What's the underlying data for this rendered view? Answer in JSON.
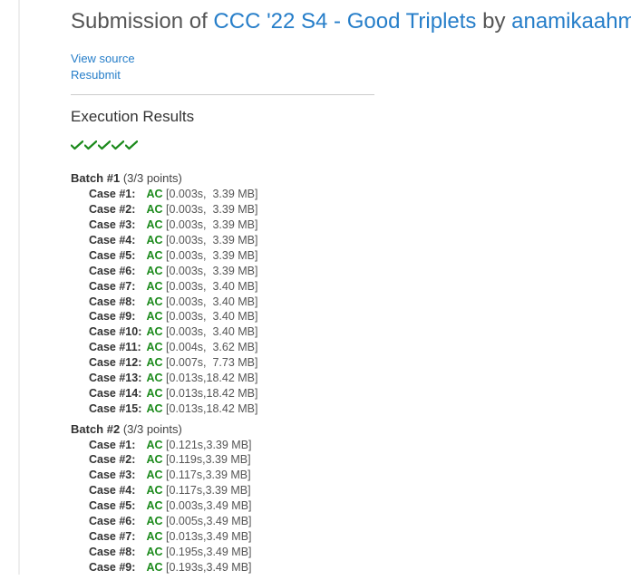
{
  "title": {
    "prefix": "Submission of ",
    "problem": "CCC '22 S4 - Good Triplets",
    "by": " by ",
    "user": "anamikaahmed"
  },
  "actions": {
    "view_source": "View source",
    "resubmit": "Resubmit"
  },
  "section_header": "Execution Results",
  "check_count": 5,
  "batches": [
    {
      "label": "Batch #1",
      "points": "(3/3 points)",
      "cases": [
        {
          "n": "Case #1:",
          "status": "AC",
          "meta": "[0.003s,  3.39 MB]"
        },
        {
          "n": "Case #2:",
          "status": "AC",
          "meta": "[0.003s,  3.39 MB]"
        },
        {
          "n": "Case #3:",
          "status": "AC",
          "meta": "[0.003s,  3.39 MB]"
        },
        {
          "n": "Case #4:",
          "status": "AC",
          "meta": "[0.003s,  3.39 MB]"
        },
        {
          "n": "Case #5:",
          "status": "AC",
          "meta": "[0.003s,  3.39 MB]"
        },
        {
          "n": "Case #6:",
          "status": "AC",
          "meta": "[0.003s,  3.39 MB]"
        },
        {
          "n": "Case #7:",
          "status": "AC",
          "meta": "[0.003s,  3.40 MB]"
        },
        {
          "n": "Case #8:",
          "status": "AC",
          "meta": "[0.003s,  3.40 MB]"
        },
        {
          "n": "Case #9:",
          "status": "AC",
          "meta": "[0.003s,  3.40 MB]"
        },
        {
          "n": "Case #10:",
          "status": "AC",
          "meta": "[0.003s,  3.40 MB]"
        },
        {
          "n": "Case #11:",
          "status": "AC",
          "meta": "[0.004s,  3.62 MB]"
        },
        {
          "n": "Case #12:",
          "status": "AC",
          "meta": "[0.007s,  7.73 MB]"
        },
        {
          "n": "Case #13:",
          "status": "AC",
          "meta": "[0.013s,18.42 MB]"
        },
        {
          "n": "Case #14:",
          "status": "AC",
          "meta": "[0.013s,18.42 MB]"
        },
        {
          "n": "Case #15:",
          "status": "AC",
          "meta": "[0.013s,18.42 MB]"
        }
      ]
    },
    {
      "label": "Batch #2",
      "points": "(3/3 points)",
      "cases": [
        {
          "n": "Case #1:",
          "status": "AC",
          "meta": "[0.121s,3.39 MB]"
        },
        {
          "n": "Case #2:",
          "status": "AC",
          "meta": "[0.119s,3.39 MB]"
        },
        {
          "n": "Case #3:",
          "status": "AC",
          "meta": "[0.117s,3.39 MB]"
        },
        {
          "n": "Case #4:",
          "status": "AC",
          "meta": "[0.117s,3.39 MB]"
        },
        {
          "n": "Case #5:",
          "status": "AC",
          "meta": "[0.003s,3.49 MB]"
        },
        {
          "n": "Case #6:",
          "status": "AC",
          "meta": "[0.005s,3.49 MB]"
        },
        {
          "n": "Case #7:",
          "status": "AC",
          "meta": "[0.013s,3.49 MB]"
        },
        {
          "n": "Case #8:",
          "status": "AC",
          "meta": "[0.195s,3.49 MB]"
        },
        {
          "n": "Case #9:",
          "status": "AC",
          "meta": "[0.193s,3.49 MB]"
        }
      ]
    }
  ]
}
